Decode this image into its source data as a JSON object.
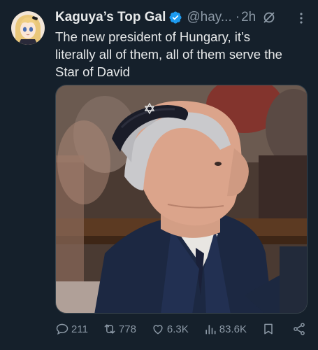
{
  "tweet": {
    "display_name": "Kaguya’s Top Gal",
    "handle": "@hay...",
    "separator": "·",
    "timestamp": "2h",
    "text": "The new president of Hungary, it’s\nliterally all of them, all of them serve the\nStar of David"
  },
  "icons": {
    "verified": "verified-badge-icon",
    "grok": "grok-icon",
    "more": "more-options-icon"
  },
  "actions": {
    "replies": "211",
    "retweets": "778",
    "likes": "6.3K",
    "views": "83.6K"
  },
  "colors": {
    "background": "#15202b",
    "text": "#e7e9ea",
    "muted": "#8b98a5",
    "verified": "#1d9bf0"
  }
}
